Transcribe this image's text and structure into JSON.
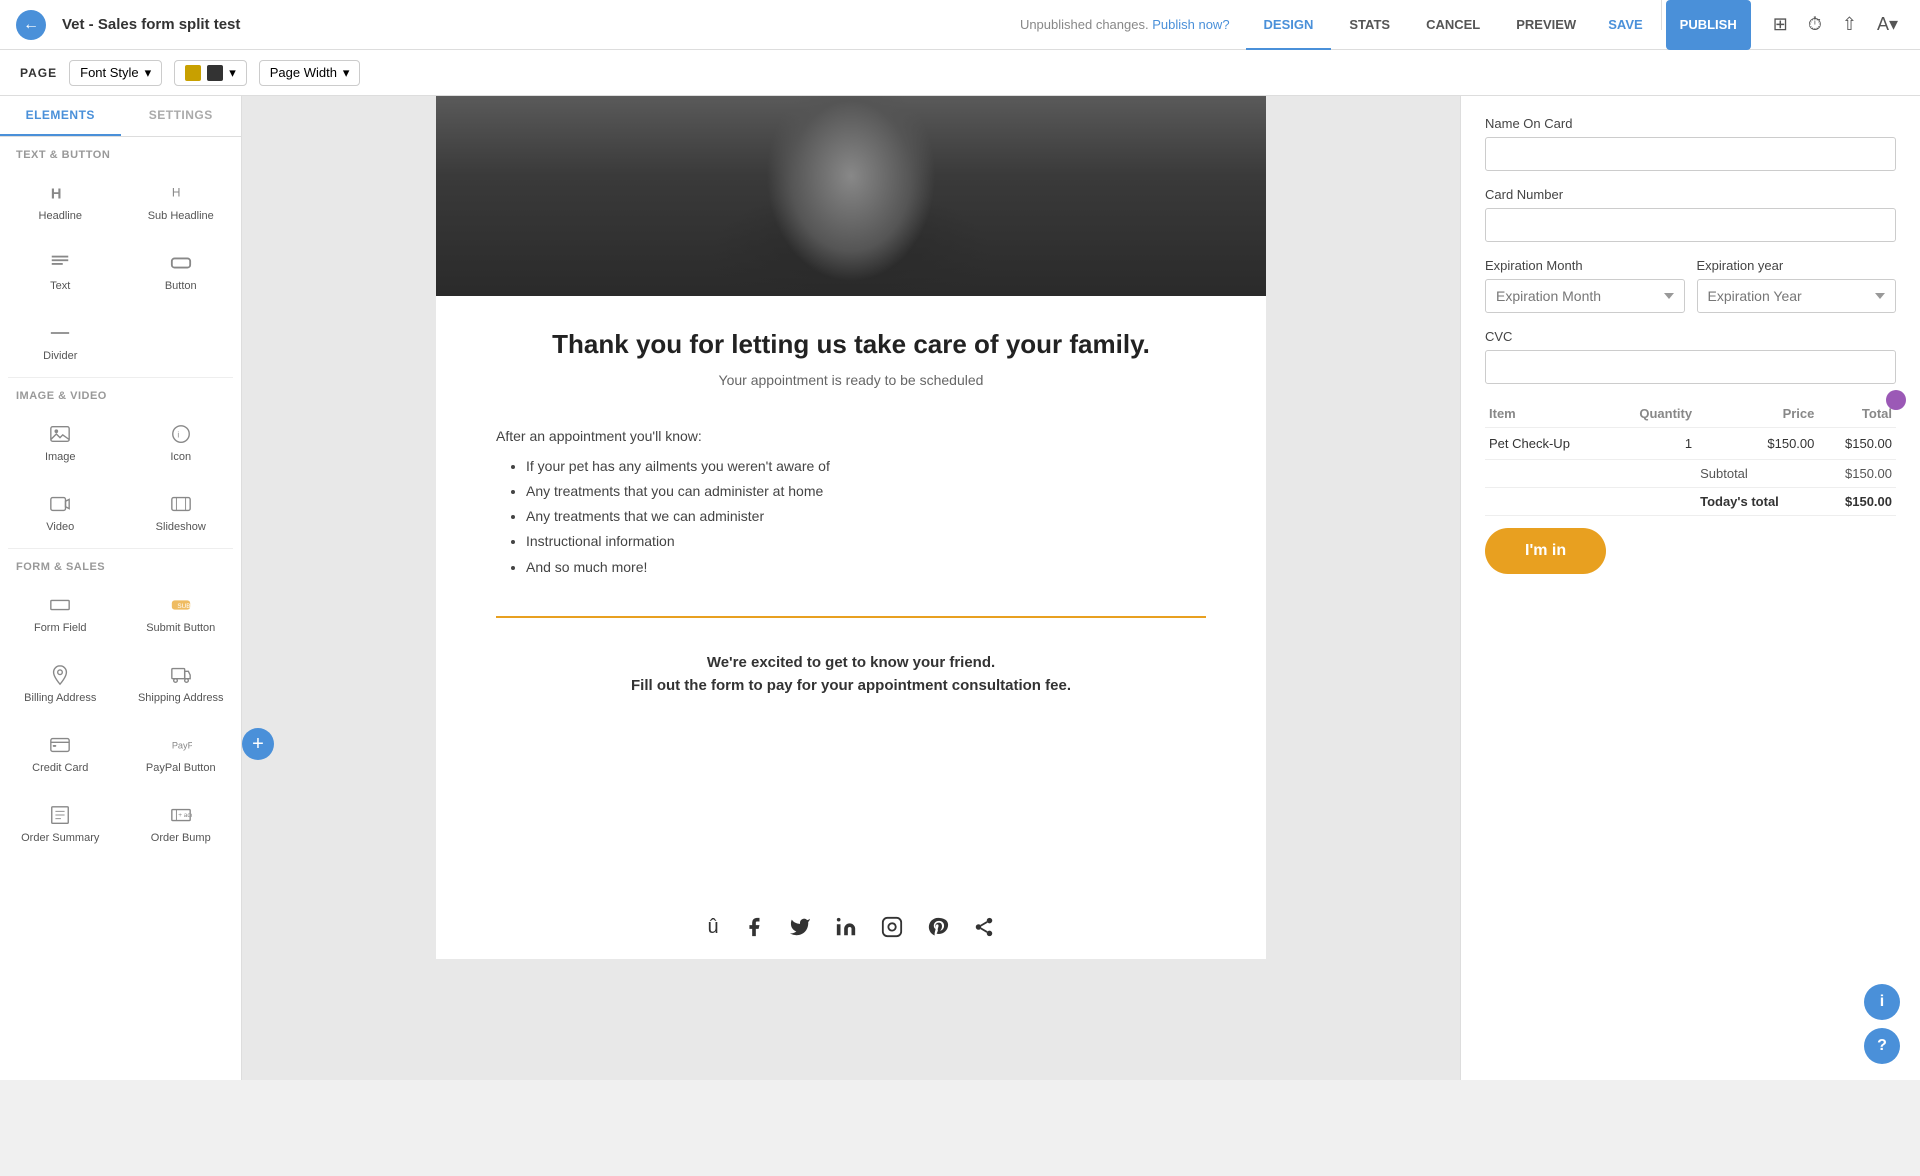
{
  "nav": {
    "back_label": "←",
    "title": "Vet - Sales form split test",
    "status": "Unpublished changes.",
    "publish_link": "Publish now?",
    "tabs": [
      "DESIGN",
      "STATS",
      "CANCEL",
      "PREVIEW",
      "SAVE",
      "PUBLISH"
    ],
    "active_tab": "DESIGN"
  },
  "toolbar": {
    "page_label": "PAGE",
    "font_style": "Font Style",
    "color_label": "Color",
    "page_width": "Page Width"
  },
  "left_panel": {
    "tabs": [
      "ELEMENTS",
      "SETTINGS"
    ],
    "active_tab": "ELEMENTS",
    "sections": [
      {
        "name": "TEXT & BUTTON",
        "items": [
          {
            "label": "Headline",
            "icon": "H"
          },
          {
            "label": "Sub Headline",
            "icon": "h"
          },
          {
            "label": "Text",
            "icon": "T"
          },
          {
            "label": "Button",
            "icon": "btn"
          },
          {
            "label": "Divider",
            "icon": "div"
          }
        ]
      },
      {
        "name": "IMAGE & VIDEO",
        "items": [
          {
            "label": "Image",
            "icon": "img"
          },
          {
            "label": "Icon",
            "icon": "ico"
          },
          {
            "label": "Video",
            "icon": "vid"
          },
          {
            "label": "Slideshow",
            "icon": "sld"
          }
        ]
      },
      {
        "name": "FORM & SALES",
        "items": [
          {
            "label": "Form Field",
            "icon": "ff"
          },
          {
            "label": "Submit Button",
            "icon": "sb"
          },
          {
            "label": "Billing Address",
            "icon": "ba"
          },
          {
            "label": "Shipping Address",
            "icon": "sa"
          },
          {
            "label": "Credit Card",
            "icon": "cc"
          },
          {
            "label": "PayPal Button",
            "icon": "pp"
          },
          {
            "label": "Order Summary",
            "icon": "os"
          },
          {
            "label": "Order Bump",
            "icon": "ob"
          }
        ]
      }
    ]
  },
  "canvas": {
    "thank_you": {
      "heading": "Thank you for letting us take care of your family.",
      "subheading": "Your appointment is ready to be scheduled",
      "after_label": "After an appointment you'll know:",
      "bullets": [
        "If your pet has any ailments you weren't aware of",
        "Any treatments that you can administer at home",
        "Any treatments that we can administer",
        "Instructional information",
        "And so much more!"
      ],
      "excited_heading": "We're excited to get to know your friend.",
      "excited_sub": "Fill out the form to pay for your appointment consultation fee."
    }
  },
  "right_form": {
    "name_on_card_label": "Name On Card",
    "name_on_card_placeholder": "",
    "card_number_label": "Card Number",
    "card_number_placeholder": "",
    "expiration_month_label": "Expiration Month",
    "expiration_month_placeholder": "Expiration Month",
    "expiration_year_label": "Expiration year",
    "expiration_year_placeholder": "Expiration Year",
    "cvc_label": "CVC",
    "cvc_placeholder": "",
    "order": {
      "headers": [
        "Item",
        "Quantity",
        "Price",
        "Total"
      ],
      "rows": [
        {
          "item": "Pet Check-Up",
          "qty": "1",
          "price": "$150.00",
          "total": "$150.00"
        }
      ],
      "subtotal_label": "Subtotal",
      "subtotal_value": "$150.00",
      "today_total_label": "Today's total",
      "today_total_value": "$150.00"
    },
    "submit_button": "I'm in"
  },
  "social": {
    "icons": [
      "facebook",
      "twitter",
      "linkedin",
      "instagram",
      "pinterest",
      "share"
    ]
  }
}
